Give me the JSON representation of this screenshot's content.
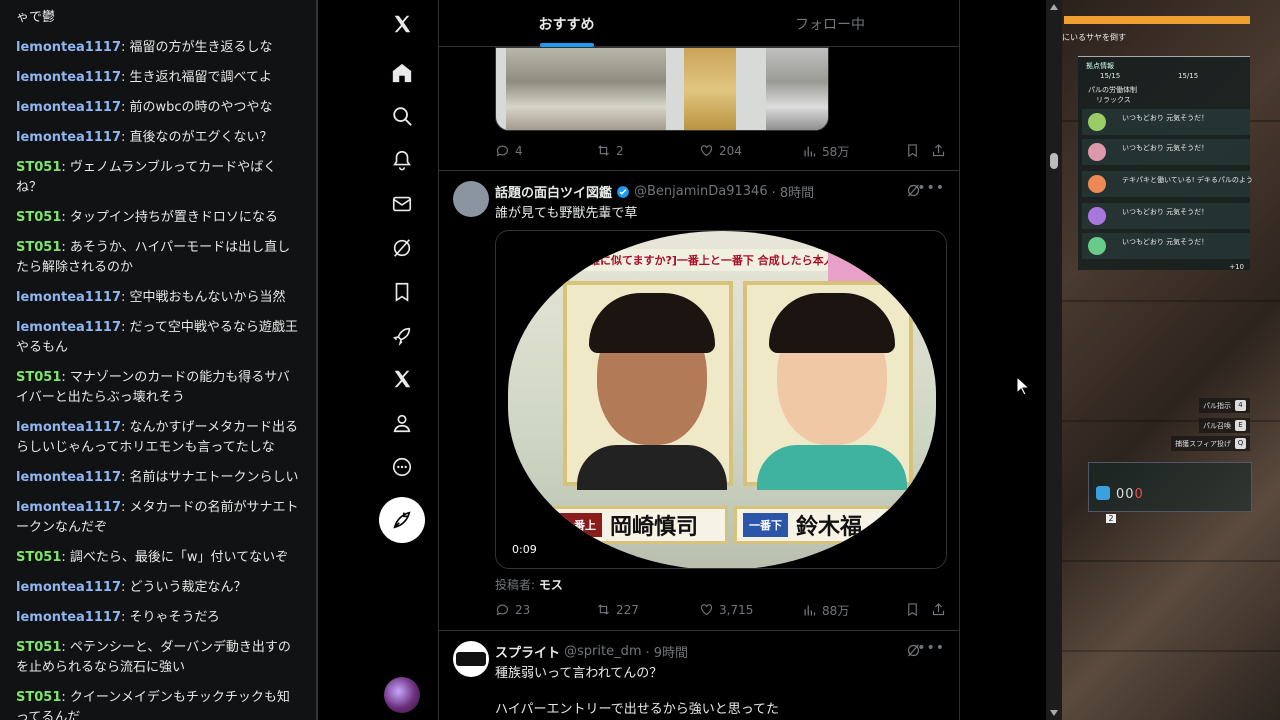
{
  "chat": {
    "messages": [
      {
        "user": "",
        "color": "",
        "text": "ゃで鬱"
      },
      {
        "user": "lemontea1117",
        "color": "blue",
        "text": "福留の方が生き返るしな"
      },
      {
        "user": "lemontea1117",
        "color": "blue",
        "text": "生き返れ福留で調べてよ"
      },
      {
        "user": "lemontea1117",
        "color": "blue",
        "text": "前のwbcの時のやつやな"
      },
      {
        "user": "lemontea1117",
        "color": "blue",
        "text": "直後なのがエグくない？"
      },
      {
        "user": "ST051",
        "color": "green",
        "text": "ヴェノムランブルってカードやばくね？"
      },
      {
        "user": "ST051",
        "color": "green",
        "text": "タップイン持ちが置きドロソになる"
      },
      {
        "user": "ST051",
        "color": "green",
        "text": "あそうか、ハイパーモードは出し直したら解除されるのか"
      },
      {
        "user": "lemontea1117",
        "color": "blue",
        "text": "空中戦おもんないから当然"
      },
      {
        "user": "lemontea1117",
        "color": "blue",
        "text": "だって空中戦やるなら遊戯王やるもん"
      },
      {
        "user": "ST051",
        "color": "green",
        "text": "マナゾーンのカードの能力も得るサバイバーと出たらぶっ壊れそう"
      },
      {
        "user": "lemontea1117",
        "color": "blue",
        "text": "なんかすげーメタカード出るらしいじゃんってホリエモンも言ってたしな"
      },
      {
        "user": "lemontea1117",
        "color": "blue",
        "text": "名前はサナエトークンらしい"
      },
      {
        "user": "lemontea1117",
        "color": "blue",
        "text": "メタカードの名前がサナエトークンなんだぞ"
      },
      {
        "user": "ST051",
        "color": "green",
        "text": "調べたら、最後に「w」付いてないぞ"
      },
      {
        "user": "lemontea1117",
        "color": "blue",
        "text": "どういう裁定なん？"
      },
      {
        "user": "lemontea1117",
        "color": "blue",
        "text": "そりゃそうだろ"
      },
      {
        "user": "ST051",
        "color": "green",
        "text": "ペテンシーと、ダーバンデ動き出すのを止められるなら流石に強い"
      },
      {
        "user": "ST051",
        "color": "green",
        "text": "クイーンメイデンもチックチックも知ってるんだ"
      }
    ]
  },
  "x": {
    "tabs": {
      "recommended": "おすすめ",
      "following": "フォロー中"
    },
    "nav_icons": [
      "x-logo-icon",
      "home-icon",
      "search-icon",
      "bell-icon",
      "mail-icon",
      "grok-icon",
      "bookmark-icon",
      "rocket-icon",
      "x-premium-icon",
      "profile-icon",
      "more-circle-icon",
      "compose-icon"
    ],
    "tweet1": {
      "replies": "4",
      "reposts": "2",
      "likes": "204",
      "views": "58万"
    },
    "tweet2": {
      "display_name": "話題の面白ツイ図鑑",
      "handle": "@BenjaminDa91346",
      "time": "· 8時間",
      "text": "誰が見ても野獣先輩で草",
      "video_banner": "人ていうと誰に似てますか?]一番上と一番下 合成したら本人とそっくり説",
      "left_label": "一番上",
      "left_name": "岡崎慎司",
      "right_label": "一番下",
      "right_name": "鈴木福",
      "video_time": "0:09",
      "poster_label": "投稿者:",
      "poster_name": "モス",
      "replies": "23",
      "reposts": "227",
      "likes": "3,715",
      "views": "88万"
    },
    "tweet3": {
      "display_name": "スプライト",
      "handle": "@sprite_dm",
      "time": "· 9時間",
      "text": "種族弱いって言われてんの？",
      "text2": "ハイパーエントリーで出せるから強いと思ってた"
    },
    "colors": {
      "accent": "#1d9bf0",
      "verified": "#1d9bf0"
    }
  },
  "game": {
    "quest": "にいるサヤを倒す",
    "base_title": "拠点情報",
    "stat1": "15/15",
    "stat2": "15/15",
    "work_label": "パルの労働体制",
    "work_value": "リラックス",
    "pals": [
      "いつもどおり 元気そうだ！",
      "いつもどおり 元気そうだ！",
      "テキパキと働いている! デキるパルのよう",
      "いつもどおり 元気そうだ！",
      "いつもどおり 元気そうだ！"
    ],
    "more": "+10",
    "keys": [
      {
        "label": "パル指示",
        "key": "4"
      },
      {
        "label": "パル召喚",
        "key": "E"
      },
      {
        "label": "捕獲スフィア投げ",
        "key": "Q"
      }
    ],
    "counter_dim": "00",
    "counter_red": "0",
    "hud_key": "2"
  }
}
